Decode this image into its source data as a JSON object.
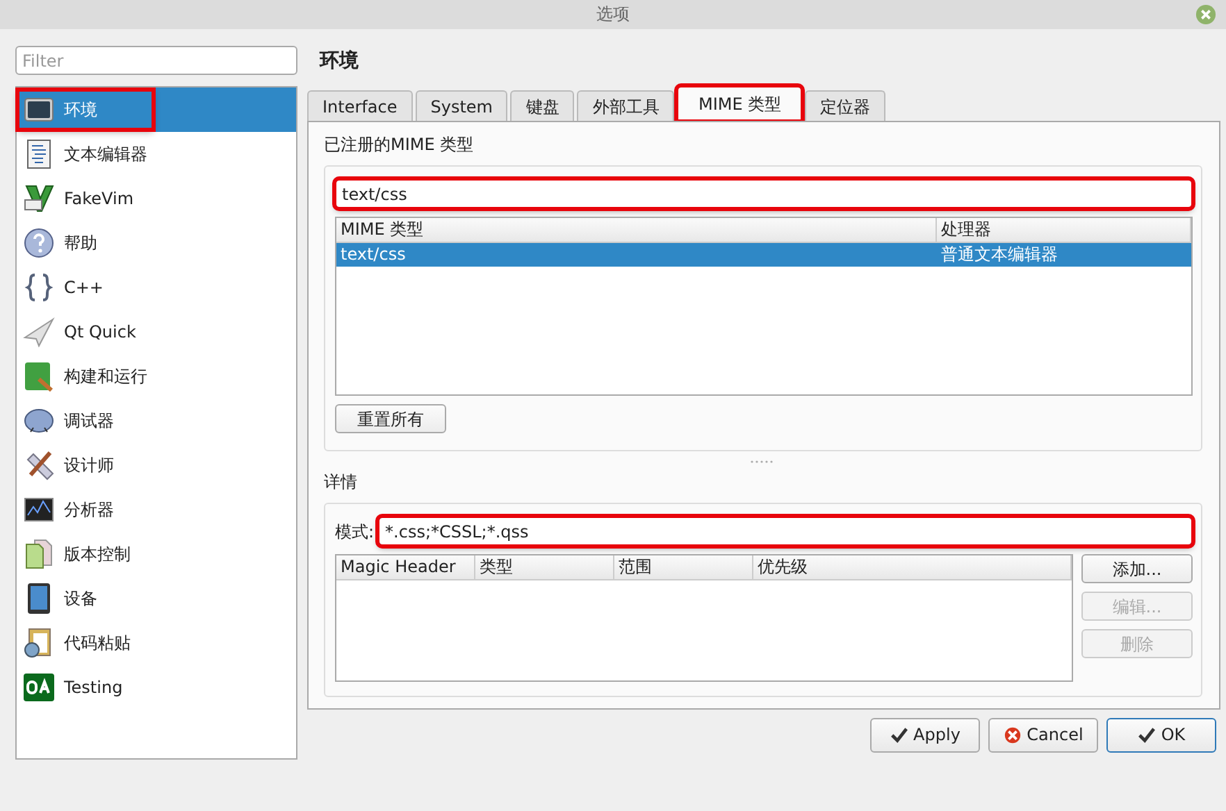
{
  "window": {
    "title": "选项"
  },
  "filter": {
    "placeholder": "Filter"
  },
  "sidebar": {
    "items": [
      {
        "label": "环境",
        "selected": true,
        "highlighted": true
      },
      {
        "label": "文本编辑器",
        "selected": false,
        "highlighted": false
      },
      {
        "label": "FakeVim",
        "selected": false,
        "highlighted": false
      },
      {
        "label": "帮助",
        "selected": false,
        "highlighted": false
      },
      {
        "label": "C++",
        "selected": false,
        "highlighted": false
      },
      {
        "label": "Qt Quick",
        "selected": false,
        "highlighted": false
      },
      {
        "label": "构建和运行",
        "selected": false,
        "highlighted": false
      },
      {
        "label": "调试器",
        "selected": false,
        "highlighted": false
      },
      {
        "label": "设计师",
        "selected": false,
        "highlighted": false
      },
      {
        "label": "分析器",
        "selected": false,
        "highlighted": false
      },
      {
        "label": "版本控制",
        "selected": false,
        "highlighted": false
      },
      {
        "label": "设备",
        "selected": false,
        "highlighted": false
      },
      {
        "label": "代码粘贴",
        "selected": false,
        "highlighted": false
      },
      {
        "label": "Testing",
        "selected": false,
        "highlighted": false
      }
    ]
  },
  "page_title": "环境",
  "tabs": [
    {
      "label": "Interface",
      "selected": false,
      "highlighted": false
    },
    {
      "label": "System",
      "selected": false,
      "highlighted": false
    },
    {
      "label": "键盘",
      "selected": false,
      "highlighted": false
    },
    {
      "label": "外部工具",
      "selected": false,
      "highlighted": false
    },
    {
      "label": "MIME 类型",
      "selected": true,
      "highlighted": true
    },
    {
      "label": "定位器",
      "selected": false,
      "highlighted": false
    }
  ],
  "registered": {
    "title": "已注册的MIME 类型",
    "search": {
      "value": "text/css",
      "highlighted": true
    },
    "table": {
      "columns": [
        "MIME 类型",
        "处理器"
      ],
      "rows": [
        {
          "cells": [
            "text/css",
            "普通文本编辑器"
          ],
          "selected": true
        }
      ]
    },
    "reset_button": "重置所有"
  },
  "details": {
    "title": "详情",
    "pattern": {
      "label": "模式:",
      "value": "*.css;*CSSL;*.qss",
      "highlighted": true,
      "focused": true
    },
    "table": {
      "columns": [
        "Magic Header",
        "类型",
        "范围",
        "优先级"
      ]
    },
    "buttons": [
      {
        "label": "添加...",
        "disabled": false
      },
      {
        "label": "编辑...",
        "disabled": true
      },
      {
        "label": "删除",
        "disabled": true
      }
    ]
  },
  "footer_buttons": [
    {
      "label": "Apply",
      "kind": "apply",
      "default": false
    },
    {
      "label": "Cancel",
      "kind": "cancel",
      "default": false
    },
    {
      "label": "OK",
      "kind": "ok",
      "default": true
    }
  ]
}
